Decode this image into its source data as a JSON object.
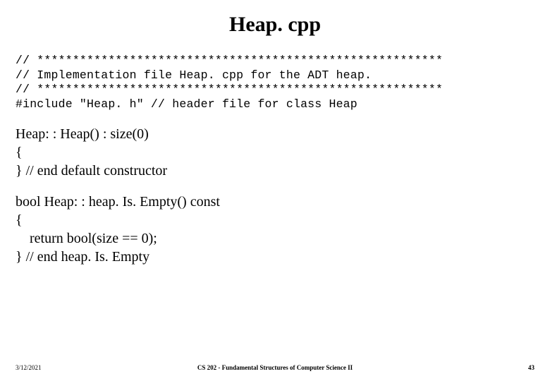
{
  "title": "Heap. cpp",
  "code": {
    "line1": "// *********************************************************",
    "line2": "// Implementation file Heap. cpp for the ADT heap.",
    "line3": "// *********************************************************",
    "line4": "#include \"Heap. h\" // header file for class Heap"
  },
  "body": {
    "block1_l1": "Heap: : Heap() : size(0)",
    "block1_l2": "{",
    "block1_l3": "} // end default constructor",
    "block2_l1": "bool Heap: : heap. Is. Empty() const",
    "block2_l2": "{",
    "block2_l3": "    return bool(size == 0);",
    "block2_l4": "} // end heap. Is. Empty"
  },
  "footer": {
    "date": "3/12/2021",
    "course": "CS 202 - Fundamental Structures of Computer Science II",
    "page": "43"
  }
}
